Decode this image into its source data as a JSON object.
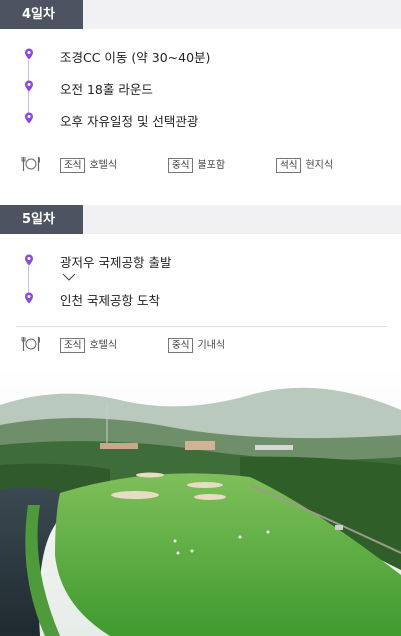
{
  "day4": {
    "label": "4일차",
    "items": [
      "조경CC 이동 (약 30~40분)",
      "오전 18홀 라운드",
      "오후 자유일정 및 선택관광"
    ],
    "meals": [
      {
        "tag": "조식",
        "text": "호텔식"
      },
      {
        "tag": "중식",
        "text": "불포함"
      },
      {
        "tag": "석식",
        "text": "현지식"
      }
    ]
  },
  "day5": {
    "label": "5일차",
    "items": [
      "광저우 국제공항 출발",
      "인천 국제공항 도착"
    ],
    "meals": [
      {
        "tag": "조식",
        "text": "호텔식"
      },
      {
        "tag": "중식",
        "text": "기내식"
      }
    ]
  },
  "icons": {
    "pin": "location-pin-icon",
    "meal": "fork-knife-plate-icon",
    "arrow": "chevron-down-icon"
  },
  "colors": {
    "accent": "#8a4bd8",
    "header_tab": "#4d5360",
    "header_bg": "#f1f1f3"
  }
}
